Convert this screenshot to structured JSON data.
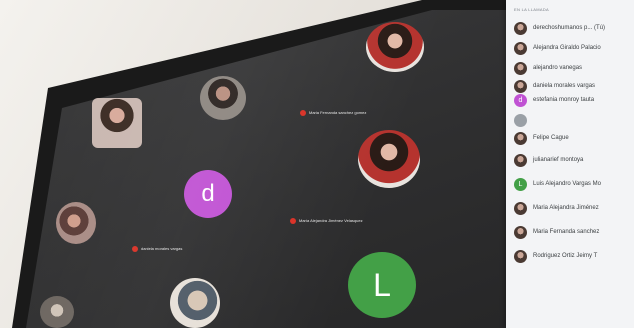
{
  "sidebar": {
    "header": "EN LA LLAMADA",
    "participants": [
      {
        "name": "derechoshumanos p... (Tú)",
        "avatar": "photo"
      },
      {
        "name": "Alejandra Giraldo Palacio",
        "avatar": "photo"
      },
      {
        "name": "alejandro vanegas",
        "avatar": "photo"
      },
      {
        "name": "daniela morales vargas",
        "avatar": "photo"
      },
      {
        "name": "estefania monroy tauta",
        "avatar": "letter",
        "initial": "d",
        "color": "#c052d3"
      },
      {
        "name": "",
        "avatar": "photo"
      },
      {
        "name": "Felipe Cague",
        "avatar": "photo"
      },
      {
        "name": "julianarief montoya",
        "avatar": "photo"
      },
      {
        "name": "Luis Alejandro Vargas Mo",
        "avatar": "letter",
        "initial": "L",
        "color": "#43a047"
      },
      {
        "name": "Maria Alejandra Jiménez",
        "avatar": "photo"
      },
      {
        "name": "Maria Fernanda sanchez",
        "avatar": "photo"
      },
      {
        "name": "Rodriguez Ortiz Jeimy T",
        "avatar": "photo"
      }
    ]
  },
  "grid": {
    "tiles": [
      {
        "kind": "photo",
        "name": ""
      },
      {
        "kind": "photo",
        "name": "Maria Fernanda sanchez gomez"
      },
      {
        "kind": "photo",
        "name": ""
      },
      {
        "kind": "photo",
        "name": "María Alejandra Jiménez Velasquez"
      },
      {
        "kind": "letter",
        "initial": "d",
        "color": "#c052d3",
        "name": ""
      },
      {
        "kind": "photo",
        "name": "daniela morales vargas"
      },
      {
        "kind": "letter",
        "initial": "L",
        "color": "#43a047",
        "name": ""
      },
      {
        "kind": "photo",
        "name": ""
      }
    ]
  },
  "colors": {
    "mic_muted": "#d93025",
    "sidebar_bg": "#f3f4f6",
    "screen_bg": "#2e2e2f"
  }
}
